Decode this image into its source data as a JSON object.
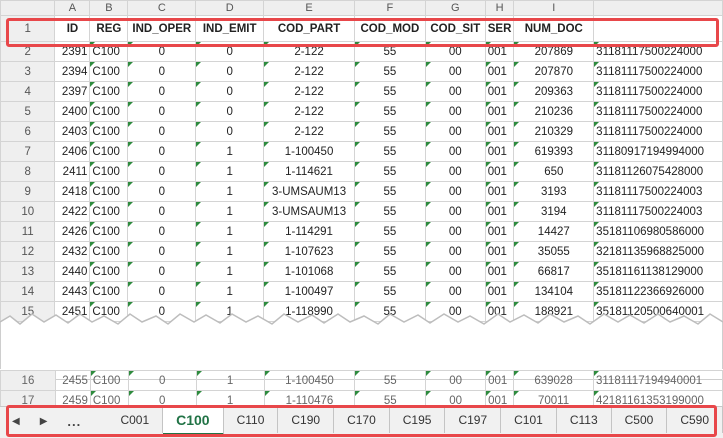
{
  "columns": [
    "A",
    "B",
    "C",
    "D",
    "E",
    "F",
    "G",
    "H",
    "I"
  ],
  "headers": [
    "ID",
    "REG",
    "IND_OPER",
    "IND_EMIT",
    "COD_PART",
    "COD_MOD",
    "COD_SIT",
    "SER",
    "NUM_DOC"
  ],
  "rows": [
    {
      "n": "2",
      "id": "2391",
      "reg": "C100",
      "oper": "0",
      "emit": "0",
      "part": "2-122",
      "mod": "55",
      "sit": "00",
      "ser": "001",
      "doc": "207869",
      "key": "31181117500224000"
    },
    {
      "n": "3",
      "id": "2394",
      "reg": "C100",
      "oper": "0",
      "emit": "0",
      "part": "2-122",
      "mod": "55",
      "sit": "00",
      "ser": "001",
      "doc": "207870",
      "key": "31181117500224000"
    },
    {
      "n": "4",
      "id": "2397",
      "reg": "C100",
      "oper": "0",
      "emit": "0",
      "part": "2-122",
      "mod": "55",
      "sit": "00",
      "ser": "001",
      "doc": "209363",
      "key": "31181117500224000"
    },
    {
      "n": "5",
      "id": "2400",
      "reg": "C100",
      "oper": "0",
      "emit": "0",
      "part": "2-122",
      "mod": "55",
      "sit": "00",
      "ser": "001",
      "doc": "210236",
      "key": "31181117500224000"
    },
    {
      "n": "6",
      "id": "2403",
      "reg": "C100",
      "oper": "0",
      "emit": "0",
      "part": "2-122",
      "mod": "55",
      "sit": "00",
      "ser": "001",
      "doc": "210329",
      "key": "31181117500224000"
    },
    {
      "n": "7",
      "id": "2406",
      "reg": "C100",
      "oper": "0",
      "emit": "1",
      "part": "1-100450",
      "mod": "55",
      "sit": "00",
      "ser": "001",
      "doc": "619393",
      "key": "31180917194994000"
    },
    {
      "n": "8",
      "id": "2411",
      "reg": "C100",
      "oper": "0",
      "emit": "1",
      "part": "1-114621",
      "mod": "55",
      "sit": "00",
      "ser": "001",
      "doc": "650",
      "key": "31181126075428000"
    },
    {
      "n": "9",
      "id": "2418",
      "reg": "C100",
      "oper": "0",
      "emit": "1",
      "part": "3-UMSAUM13",
      "mod": "55",
      "sit": "00",
      "ser": "001",
      "doc": "3193",
      "key": "31181117500224003"
    },
    {
      "n": "10",
      "id": "2422",
      "reg": "C100",
      "oper": "0",
      "emit": "1",
      "part": "3-UMSAUM13",
      "mod": "55",
      "sit": "00",
      "ser": "001",
      "doc": "3194",
      "key": "31181117500224003"
    },
    {
      "n": "11",
      "id": "2426",
      "reg": "C100",
      "oper": "0",
      "emit": "1",
      "part": "1-114291",
      "mod": "55",
      "sit": "00",
      "ser": "001",
      "doc": "14427",
      "key": "35181106980586000"
    },
    {
      "n": "12",
      "id": "2432",
      "reg": "C100",
      "oper": "0",
      "emit": "1",
      "part": "1-107623",
      "mod": "55",
      "sit": "00",
      "ser": "001",
      "doc": "35055",
      "key": "32181135968825000"
    },
    {
      "n": "13",
      "id": "2440",
      "reg": "C100",
      "oper": "0",
      "emit": "1",
      "part": "1-101068",
      "mod": "55",
      "sit": "00",
      "ser": "001",
      "doc": "66817",
      "key": "35181161138129000"
    },
    {
      "n": "14",
      "id": "2443",
      "reg": "C100",
      "oper": "0",
      "emit": "1",
      "part": "1-100497",
      "mod": "55",
      "sit": "00",
      "ser": "001",
      "doc": "134104",
      "key": "35181122366926000"
    },
    {
      "n": "15",
      "id": "2451",
      "reg": "C100",
      "oper": "0",
      "emit": "1",
      "part": "1-118990",
      "mod": "55",
      "sit": "00",
      "ser": "001",
      "doc": "188921",
      "key": "35181120500640001"
    }
  ],
  "bottom_rows": [
    {
      "n": "16",
      "id": "2455",
      "reg": "C100",
      "oper": "0",
      "emit": "1",
      "part": "1-100450",
      "mod": "55",
      "sit": "00",
      "ser": "001",
      "doc": "639028",
      "key": "31181117194940001"
    },
    {
      "n": "17",
      "id": "2459",
      "reg": "C100",
      "oper": "0",
      "emit": "1",
      "part": "1-110476",
      "mod": "55",
      "sit": "00",
      "ser": "001",
      "doc": "70011",
      "key": "42181161353199000"
    }
  ],
  "sheet_tabs": {
    "ellipsis": "...",
    "tabs": [
      "C001",
      "C100",
      "C110",
      "C190",
      "C170",
      "C195",
      "C197",
      "C101",
      "C113",
      "C500",
      "C590"
    ],
    "active": "C100"
  },
  "colors": {
    "highlight": "#e8474a",
    "active_tab": "#217346",
    "error_triangle": "#2e8b3e"
  }
}
